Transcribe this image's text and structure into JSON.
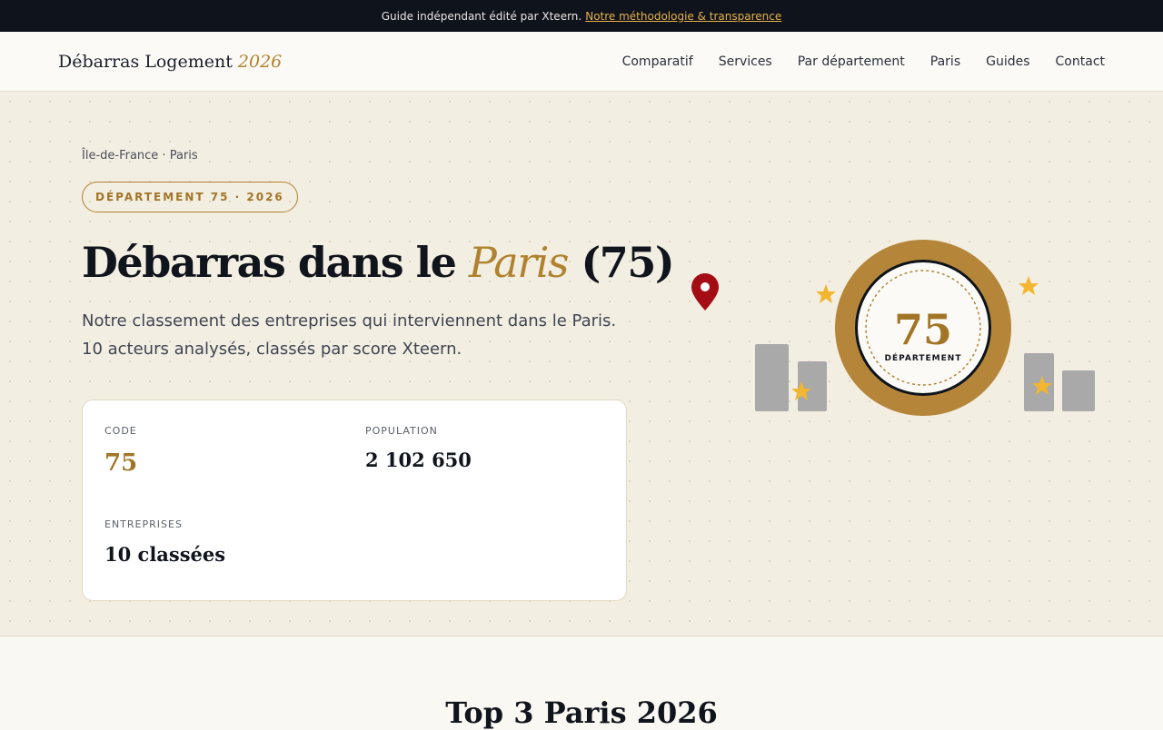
{
  "topbar": {
    "text": "Guide indépendant édité par Xteern.",
    "link": "Notre méthodologie & transparence"
  },
  "nav": {
    "brand": "Débarras Logement",
    "brand_year": "2026",
    "items": [
      "Comparatif",
      "Services",
      "Par département",
      "Paris",
      "Guides",
      "Contact"
    ]
  },
  "hero": {
    "breadcrumb": "Île-de-France · Paris",
    "badge": "DÉPARTEMENT 75 · 2026",
    "title_prefix": "Débarras dans le",
    "title_place": "Paris",
    "title_suffix": "(75)",
    "lead": "Notre classement des entreprises qui interviennent dans le Paris. 10 acteurs analysés, classés par score Xteern."
  },
  "stats": {
    "code_label": "CODE",
    "code_value": "75",
    "population_label": "POPULATION",
    "population_value": "2 102 650",
    "companies_label": "ENTREPRISES",
    "companies_value": "10 classées"
  },
  "illustration": {
    "medal_number": "75",
    "medal_label": "DÉPARTEMENT",
    "gold": "#b5863a",
    "pin_color": "#a30d13",
    "star_color": "#f2b632",
    "building_color": "#a9a9a9"
  },
  "section": {
    "title": "Top 3 Paris 2026"
  },
  "colors": {
    "accent": "#b0822e",
    "dark": "#0e131c",
    "link": "#e8b04a"
  }
}
